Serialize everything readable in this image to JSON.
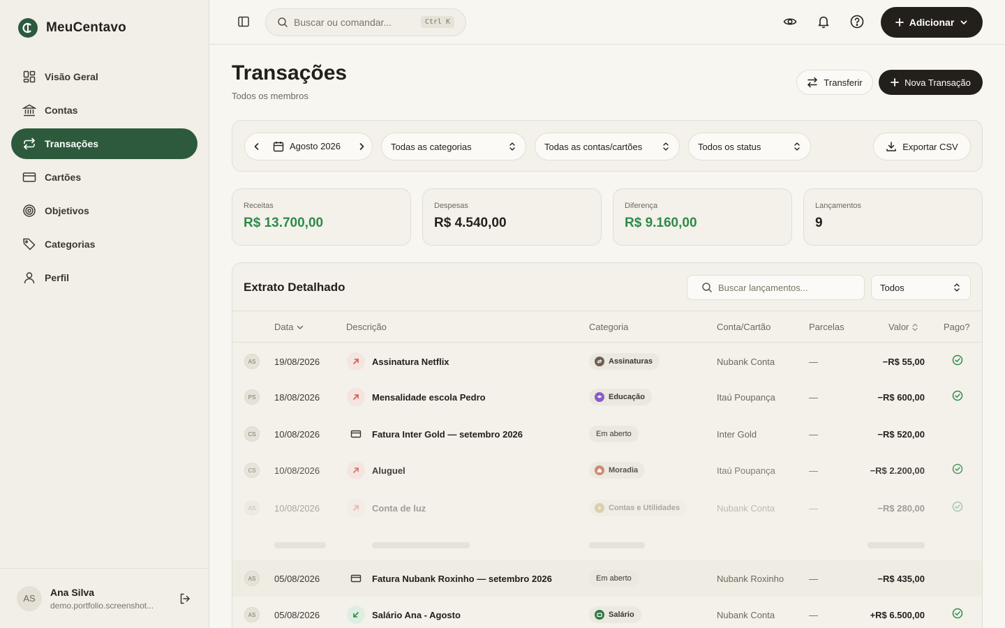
{
  "brand": {
    "name": "MeuCentavo"
  },
  "nav": {
    "items": [
      {
        "label": "Visão Geral",
        "icon": "dashboard-icon"
      },
      {
        "label": "Contas",
        "icon": "bank-icon"
      },
      {
        "label": "Transações",
        "icon": "transfer-arrows-icon",
        "active": true
      },
      {
        "label": "Cartões",
        "icon": "credit-card-icon"
      },
      {
        "label": "Objetivos",
        "icon": "target-icon"
      },
      {
        "label": "Categorias",
        "icon": "tag-icon"
      },
      {
        "label": "Perfil",
        "icon": "user-icon"
      }
    ]
  },
  "user": {
    "initials": "AS",
    "name": "Ana Silva",
    "email": "demo.portfolio.screenshot..."
  },
  "topbar": {
    "search_placeholder": "Buscar ou comandar...",
    "shortcut": "Ctrl K",
    "add_label": "Adicionar"
  },
  "page": {
    "title": "Transações",
    "subtitle": "Todos os membros",
    "transfer_label": "Transferir",
    "new_label": "Nova Transação"
  },
  "filters": {
    "period": "Agosto 2026",
    "category": "Todas as categorias",
    "account": "Todas as contas/cartões",
    "status": "Todos os status",
    "export_label": "Exportar CSV"
  },
  "stats": [
    {
      "label": "Receitas",
      "value": "R$ 13.700,00",
      "tone": "green"
    },
    {
      "label": "Despesas",
      "value": "R$ 4.540,00",
      "tone": "dark"
    },
    {
      "label": "Diferença",
      "value": "R$ 9.160,00",
      "tone": "green"
    },
    {
      "label": "Lançamentos",
      "value": "9",
      "tone": "dark"
    }
  ],
  "statement": {
    "title": "Extrato Detalhado",
    "search_placeholder": "Buscar lançamentos...",
    "type_filter": "Todos",
    "columns": {
      "date": "Data",
      "description": "Descrição",
      "category": "Categoria",
      "account": "Conta/Cartão",
      "installments": "Parcelas",
      "value": "Valor",
      "paid": "Pago?"
    },
    "rows": [
      {
        "member": "AS",
        "date": "19/08/2026",
        "type": "out",
        "description": "Assinatura Netflix",
        "category": "Assinaturas",
        "cat_color": "#6b5f50",
        "account": "Nubank Conta",
        "installments": "—",
        "amount": "−R$ 55,00",
        "paid": true
      },
      {
        "member": "PS",
        "date": "18/08/2026",
        "type": "out",
        "description": "Mensalidade escola Pedro",
        "category": "Educação",
        "cat_color": "#8a5cc8",
        "account": "Itaú Poupança",
        "installments": "—",
        "amount": "−R$ 600,00",
        "paid": true
      },
      {
        "member": "CS",
        "date": "10/08/2026",
        "type": "card",
        "description": "Fatura Inter Gold — setembro 2026",
        "category": "Em aberto",
        "cat_color": "",
        "account": "Inter Gold",
        "installments": "—",
        "amount": "−R$ 520,00",
        "paid": false
      },
      {
        "member": "CS",
        "date": "10/08/2026",
        "type": "out",
        "description": "Aluguel",
        "category": "Moradia",
        "cat_color": "#c97a5e",
        "account": "Itaú Poupança",
        "installments": "—",
        "amount": "−R$ 2.200,00",
        "paid": true
      },
      {
        "member": "AS",
        "date": "10/08/2026",
        "type": "out",
        "description": "Conta de luz",
        "category": "Contas e Utilidades",
        "cat_color": "#b3a24a",
        "account": "Nubank Conta",
        "installments": "—",
        "amount": "−R$ 280,00",
        "paid": true
      },
      {
        "member": "AS",
        "date": "05/08/2026",
        "type": "card",
        "description": "Fatura Nubank Roxinho — setembro 2026",
        "category": "Em aberto",
        "cat_color": "",
        "account": "Nubank Roxinho",
        "installments": "—",
        "amount": "−R$ 435,00",
        "paid": false
      },
      {
        "member": "AS",
        "date": "05/08/2026",
        "type": "in",
        "description": "Salário Ana - Agosto",
        "category": "Salário",
        "cat_color": "#2d7a45",
        "account": "Nubank Conta",
        "installments": "—",
        "amount": "+R$ 6.500,00",
        "paid": true
      }
    ]
  },
  "colors": {
    "accent": "#2d5a3d",
    "positive": "#2e8a4a",
    "dark": "#23201c"
  }
}
